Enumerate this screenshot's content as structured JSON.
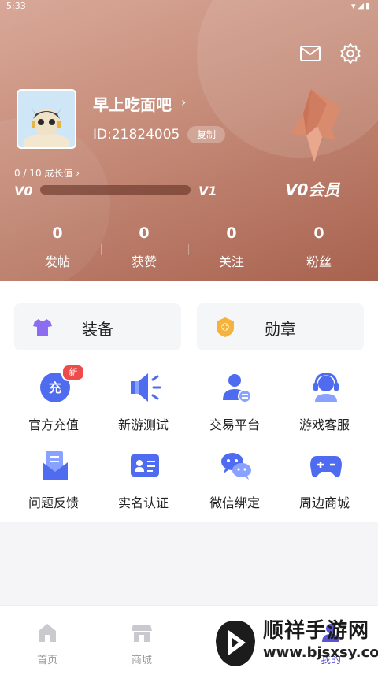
{
  "status_bar": {
    "time": "5:33"
  },
  "profile": {
    "nickname": "早上吃面吧",
    "id_text": "ID:21824005",
    "copy_label": "复制",
    "growth_text": "0 / 10 成长值",
    "growth_progress": 0,
    "level_current": "V0",
    "level_next": "V1",
    "vip_label": "V0会员"
  },
  "stats": [
    {
      "value": "0",
      "label": "发帖"
    },
    {
      "value": "0",
      "label": "获赞"
    },
    {
      "value": "0",
      "label": "关注"
    },
    {
      "value": "0",
      "label": "粉丝"
    }
  ],
  "quick_buttons": [
    {
      "label": "装备",
      "icon": "tshirt-icon"
    },
    {
      "label": "勋章",
      "icon": "medal-icon"
    }
  ],
  "grid": [
    {
      "label": "官方充值",
      "icon": "recharge-icon",
      "tag": "新",
      "tag_char": "充"
    },
    {
      "label": "新游测试",
      "icon": "megaphone-icon"
    },
    {
      "label": "交易平台",
      "icon": "trade-icon"
    },
    {
      "label": "游戏客服",
      "icon": "headset-icon"
    },
    {
      "label": "问题反馈",
      "icon": "feedback-icon"
    },
    {
      "label": "实名认证",
      "icon": "id-card-icon"
    },
    {
      "label": "微信绑定",
      "icon": "wechat-icon"
    },
    {
      "label": "周边商城",
      "icon": "gamepad-icon"
    }
  ],
  "tabs": [
    {
      "label": "首页",
      "icon": "home-icon"
    },
    {
      "label": "商城",
      "icon": "store-icon"
    },
    {
      "label": "",
      "icon": "discover-icon"
    },
    {
      "label": "我的",
      "icon": "profile-icon"
    }
  ],
  "watermark": {
    "title": "顺祥手游网",
    "url": "www.bjsxsy.com"
  },
  "colors": {
    "header": "#c58b78",
    "accent": "#5a55d8",
    "icon_blue": "#4f6cf0",
    "new_tag": "#ee4b4b"
  }
}
